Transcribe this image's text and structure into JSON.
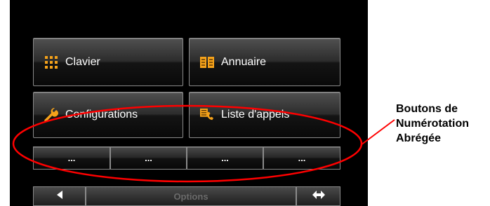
{
  "menu": {
    "clavier": {
      "label": "Clavier",
      "icon": "keypad-grid-icon"
    },
    "annuaire": {
      "label": "Annuaire",
      "icon": "phonebook-icon"
    },
    "configurations": {
      "label": "Configurations",
      "icon": "wrench-icon"
    },
    "liste_appels": {
      "label": "Liste d'appels",
      "icon": "call-list-icon"
    }
  },
  "speed_dial": [
    {
      "label": "..."
    },
    {
      "label": "..."
    },
    {
      "label": "..."
    },
    {
      "label": "..."
    }
  ],
  "bottom_bar": {
    "options_label": "Options",
    "left_icon": "triangle-left-icon",
    "right_icon": "left-right-arrows-icon"
  },
  "annotation": {
    "line1": "Boutons de",
    "line2": "Numérotation",
    "line3": "Abrégée",
    "color": "#ff0000"
  },
  "colors": {
    "icon_orange": "#f5a21a",
    "screen_background": "#000000"
  }
}
